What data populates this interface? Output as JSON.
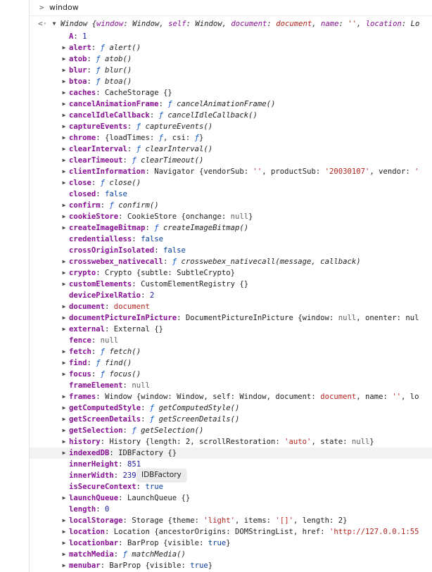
{
  "console": {
    "prompt_symbol": ">",
    "command": "window",
    "result_arrow": "<·"
  },
  "window_object": {
    "head": [
      {
        "t": "Window {",
        "c": "ctor"
      },
      {
        "t": "window",
        "c": "kprop"
      },
      {
        "t": ": Window, ",
        "c": "ctor"
      },
      {
        "t": "self",
        "c": "kprop"
      },
      {
        "t": ": Window, ",
        "c": "ctor"
      },
      {
        "t": "document",
        "c": "kprop"
      },
      {
        "t": ": ",
        "c": "ctor"
      },
      {
        "t": "document",
        "c": "str"
      },
      {
        "t": ", ",
        "c": "ctor"
      },
      {
        "t": "name",
        "c": "kprop"
      },
      {
        "t": ": ",
        "c": "ctor"
      },
      {
        "t": "''",
        "c": "str"
      },
      {
        "t": ", ",
        "c": "ctor"
      },
      {
        "t": "location",
        "c": "kprop"
      },
      {
        "t": ": Lo",
        "c": "ctor"
      }
    ],
    "properties": [
      {
        "key": "A",
        "expand": false,
        "parts": [
          {
            "t": "1",
            "c": "num"
          }
        ]
      },
      {
        "key": "alert",
        "expand": true,
        "parts": [
          {
            "t": "ƒ ",
            "c": "f"
          },
          {
            "t": "alert()",
            "c": "fn"
          }
        ]
      },
      {
        "key": "atob",
        "expand": true,
        "parts": [
          {
            "t": "ƒ ",
            "c": "f"
          },
          {
            "t": "atob()",
            "c": "fn"
          }
        ]
      },
      {
        "key": "blur",
        "expand": true,
        "parts": [
          {
            "t": "ƒ ",
            "c": "f"
          },
          {
            "t": "blur()",
            "c": "fn"
          }
        ]
      },
      {
        "key": "btoa",
        "expand": true,
        "parts": [
          {
            "t": "ƒ ",
            "c": "f"
          },
          {
            "t": "btoa()",
            "c": "fn"
          }
        ]
      },
      {
        "key": "caches",
        "expand": true,
        "parts": [
          {
            "t": "CacheStorage {}",
            "c": "ctor"
          }
        ]
      },
      {
        "key": "cancelAnimationFrame",
        "expand": true,
        "parts": [
          {
            "t": "ƒ ",
            "c": "f"
          },
          {
            "t": "cancelAnimationFrame()",
            "c": "fn"
          }
        ]
      },
      {
        "key": "cancelIdleCallback",
        "expand": true,
        "parts": [
          {
            "t": "ƒ ",
            "c": "f"
          },
          {
            "t": "cancelIdleCallback()",
            "c": "fn"
          }
        ]
      },
      {
        "key": "captureEvents",
        "expand": true,
        "parts": [
          {
            "t": "ƒ ",
            "c": "f"
          },
          {
            "t": "captureEvents()",
            "c": "fn"
          }
        ]
      },
      {
        "key": "chrome",
        "expand": true,
        "parts": [
          {
            "t": "{loadTimes: ",
            "c": "ctor"
          },
          {
            "t": "ƒ",
            "c": "f"
          },
          {
            "t": ", csi: ",
            "c": "ctor"
          },
          {
            "t": "ƒ",
            "c": "f"
          },
          {
            "t": "}",
            "c": "ctor"
          }
        ]
      },
      {
        "key": "clearInterval",
        "expand": true,
        "parts": [
          {
            "t": "ƒ ",
            "c": "f"
          },
          {
            "t": "clearInterval()",
            "c": "fn"
          }
        ]
      },
      {
        "key": "clearTimeout",
        "expand": true,
        "parts": [
          {
            "t": "ƒ ",
            "c": "f"
          },
          {
            "t": "clearTimeout()",
            "c": "fn"
          }
        ]
      },
      {
        "key": "clientInformation",
        "expand": true,
        "parts": [
          {
            "t": "Navigator {vendorSub: ",
            "c": "ctor"
          },
          {
            "t": "''",
            "c": "str"
          },
          {
            "t": ", productSub: ",
            "c": "ctor"
          },
          {
            "t": "'20030107'",
            "c": "str"
          },
          {
            "t": ", vendor: ",
            "c": "ctor"
          },
          {
            "t": "'",
            "c": "str"
          }
        ]
      },
      {
        "key": "close",
        "expand": true,
        "parts": [
          {
            "t": "ƒ ",
            "c": "f"
          },
          {
            "t": "close()",
            "c": "fn"
          }
        ]
      },
      {
        "key": "closed",
        "expand": false,
        "parts": [
          {
            "t": "false",
            "c": "kw"
          }
        ]
      },
      {
        "key": "confirm",
        "expand": true,
        "parts": [
          {
            "t": "ƒ ",
            "c": "f"
          },
          {
            "t": "confirm()",
            "c": "fn"
          }
        ]
      },
      {
        "key": "cookieStore",
        "expand": true,
        "parts": [
          {
            "t": "CookieStore {onchange: ",
            "c": "ctor"
          },
          {
            "t": "null",
            "c": "muted"
          },
          {
            "t": "}",
            "c": "ctor"
          }
        ]
      },
      {
        "key": "createImageBitmap",
        "expand": true,
        "parts": [
          {
            "t": "ƒ ",
            "c": "f"
          },
          {
            "t": "createImageBitmap()",
            "c": "fn"
          }
        ]
      },
      {
        "key": "credentialless",
        "expand": false,
        "parts": [
          {
            "t": "false",
            "c": "kw"
          }
        ]
      },
      {
        "key": "crossOriginIsolated",
        "expand": false,
        "parts": [
          {
            "t": "false",
            "c": "kw"
          }
        ]
      },
      {
        "key": "crosswebex_nativecall",
        "expand": true,
        "parts": [
          {
            "t": "ƒ ",
            "c": "f"
          },
          {
            "t": "crosswebex_nativecall(message, callback)",
            "c": "fn"
          }
        ]
      },
      {
        "key": "crypto",
        "expand": true,
        "parts": [
          {
            "t": "Crypto {subtle: SubtleCrypto}",
            "c": "ctor"
          }
        ]
      },
      {
        "key": "customElements",
        "expand": true,
        "parts": [
          {
            "t": "CustomElementRegistry {}",
            "c": "ctor"
          }
        ]
      },
      {
        "key": "devicePixelRatio",
        "expand": false,
        "parts": [
          {
            "t": "2",
            "c": "num"
          }
        ]
      },
      {
        "key": "document",
        "expand": true,
        "parts": [
          {
            "t": "document",
            "c": "str"
          }
        ]
      },
      {
        "key": "documentPictureInPicture",
        "expand": true,
        "parts": [
          {
            "t": "DocumentPictureInPicture {window: ",
            "c": "ctor"
          },
          {
            "t": "null",
            "c": "muted"
          },
          {
            "t": ", onenter: nul",
            "c": "ctor"
          }
        ]
      },
      {
        "key": "external",
        "expand": true,
        "parts": [
          {
            "t": "External {}",
            "c": "ctor"
          }
        ]
      },
      {
        "key": "fence",
        "expand": false,
        "parts": [
          {
            "t": "null",
            "c": "muted"
          }
        ]
      },
      {
        "key": "fetch",
        "expand": true,
        "parts": [
          {
            "t": "ƒ ",
            "c": "f"
          },
          {
            "t": "fetch()",
            "c": "fn"
          }
        ]
      },
      {
        "key": "find",
        "expand": true,
        "parts": [
          {
            "t": "ƒ ",
            "c": "f"
          },
          {
            "t": "find()",
            "c": "fn"
          }
        ]
      },
      {
        "key": "focus",
        "expand": true,
        "parts": [
          {
            "t": "ƒ ",
            "c": "f"
          },
          {
            "t": "focus()",
            "c": "fn"
          }
        ]
      },
      {
        "key": "frameElement",
        "expand": false,
        "parts": [
          {
            "t": "null",
            "c": "muted"
          }
        ]
      },
      {
        "key": "frames",
        "expand": true,
        "parts": [
          {
            "t": "Window {window: Window, self: Window, document: ",
            "c": "ctor"
          },
          {
            "t": "document",
            "c": "str"
          },
          {
            "t": ", name: ",
            "c": "ctor"
          },
          {
            "t": "''",
            "c": "str"
          },
          {
            "t": ", lo",
            "c": "ctor"
          }
        ]
      },
      {
        "key": "getComputedStyle",
        "expand": true,
        "parts": [
          {
            "t": "ƒ ",
            "c": "f"
          },
          {
            "t": "getComputedStyle()",
            "c": "fn"
          }
        ]
      },
      {
        "key": "getScreenDetails",
        "expand": true,
        "parts": [
          {
            "t": "ƒ ",
            "c": "f"
          },
          {
            "t": "getScreenDetails()",
            "c": "fn"
          }
        ]
      },
      {
        "key": "getSelection",
        "expand": true,
        "parts": [
          {
            "t": "ƒ ",
            "c": "f"
          },
          {
            "t": "getSelection()",
            "c": "fn"
          }
        ]
      },
      {
        "key": "history",
        "expand": true,
        "parts": [
          {
            "t": "History {length: 2, scrollRestoration: ",
            "c": "ctor"
          },
          {
            "t": "'auto'",
            "c": "str"
          },
          {
            "t": ", state: ",
            "c": "ctor"
          },
          {
            "t": "null",
            "c": "muted"
          },
          {
            "t": "}",
            "c": "ctor"
          }
        ]
      },
      {
        "key": "indexedDB",
        "expand": true,
        "highlight": true,
        "parts": [
          {
            "t": "IDBFactory {}",
            "c": "ctor"
          }
        ]
      },
      {
        "key": "innerHeight",
        "expand": false,
        "parts": [
          {
            "t": "851",
            "c": "num"
          }
        ]
      },
      {
        "key": "innerWidth",
        "expand": false,
        "parts": [
          {
            "t": "239",
            "c": "num"
          }
        ]
      },
      {
        "key": "isSecureContext",
        "expand": false,
        "parts": [
          {
            "t": "true",
            "c": "kw"
          }
        ]
      },
      {
        "key": "launchQueue",
        "expand": true,
        "parts": [
          {
            "t": "LaunchQueue {}",
            "c": "ctor"
          }
        ]
      },
      {
        "key": "length",
        "expand": false,
        "parts": [
          {
            "t": "0",
            "c": "num"
          }
        ]
      },
      {
        "key": "localStorage",
        "expand": true,
        "parts": [
          {
            "t": "Storage {theme: ",
            "c": "ctor"
          },
          {
            "t": "'light'",
            "c": "str"
          },
          {
            "t": ", items: ",
            "c": "ctor"
          },
          {
            "t": "'[]'",
            "c": "str"
          },
          {
            "t": ", length: 2}",
            "c": "ctor"
          }
        ]
      },
      {
        "key": "location",
        "expand": true,
        "parts": [
          {
            "t": "Location {ancestorOrigins: DOMStringList, href: ",
            "c": "ctor"
          },
          {
            "t": "'http://127.0.0.1:55",
            "c": "str"
          }
        ]
      },
      {
        "key": "locationbar",
        "expand": true,
        "parts": [
          {
            "t": "BarProp {visible: ",
            "c": "ctor"
          },
          {
            "t": "true",
            "c": "kw"
          },
          {
            "t": "}",
            "c": "ctor"
          }
        ]
      },
      {
        "key": "matchMedia",
        "expand": true,
        "parts": [
          {
            "t": "ƒ ",
            "c": "f"
          },
          {
            "t": "matchMedia()",
            "c": "fn"
          }
        ]
      },
      {
        "key": "menubar",
        "expand": true,
        "parts": [
          {
            "t": "BarProp {visible: ",
            "c": "ctor"
          },
          {
            "t": "true",
            "c": "kw"
          },
          {
            "t": "}",
            "c": "ctor"
          }
        ]
      }
    ]
  },
  "tooltip": {
    "text": "IDBFactory"
  }
}
